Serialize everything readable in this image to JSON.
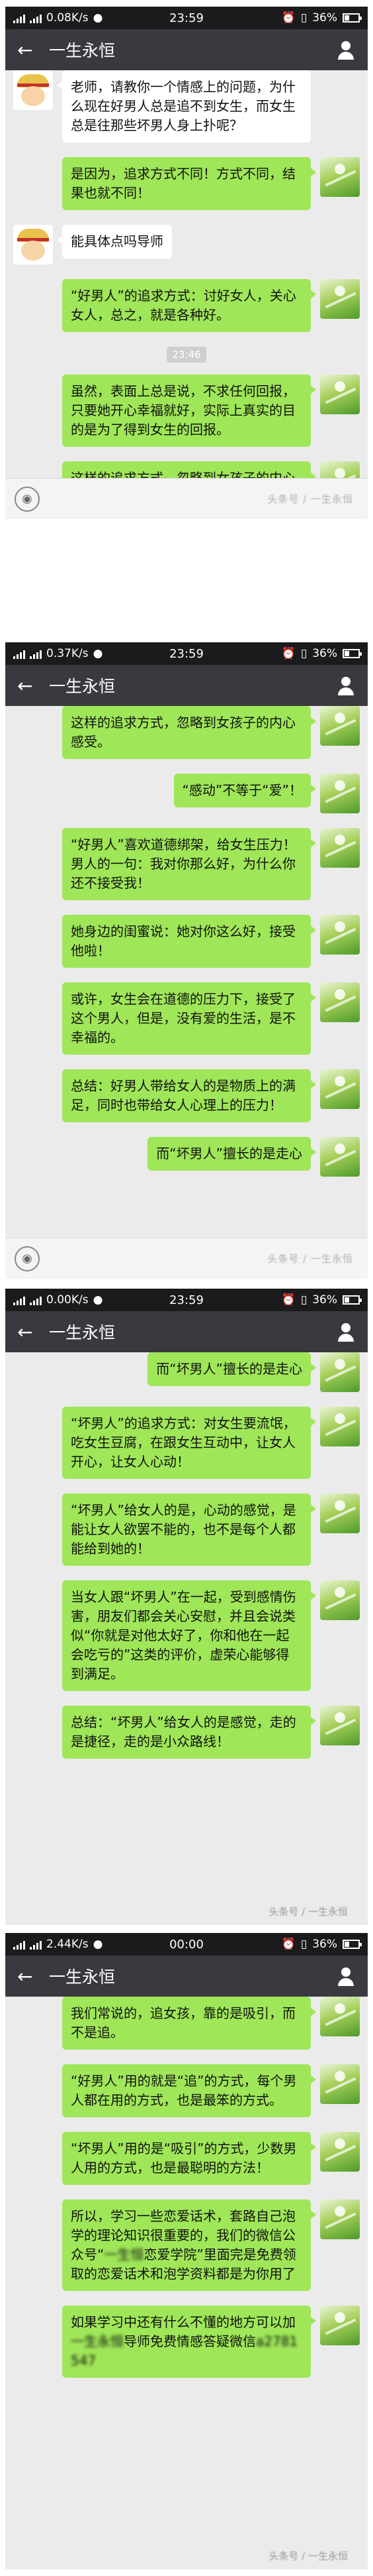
{
  "contact_name": "一生永恒",
  "back_glyph": "←",
  "panels": [
    {
      "status": {
        "speed": "0.08K/s",
        "time": "23:59",
        "battery": "36%"
      },
      "watermark": "头条号 / 一生永恒",
      "messages": [
        {
          "type": "left",
          "text": "老师，请教你一个情感上的问题，为什么现在好男人总是追不到女生，而女生总是往那些坏男人身上扑呢？"
        },
        {
          "type": "right",
          "text": "是因为，追求方式不同！方式不同，结果也就不同！"
        },
        {
          "type": "left",
          "text": "能具体点吗导师"
        },
        {
          "type": "right",
          "text": "“好男人”的追求方式：讨好女人，关心女人，总之，就是各种好。"
        },
        {
          "type": "time",
          "text": "23:46"
        },
        {
          "type": "right",
          "text": "虽然，表面上总是说，不求任何回报，只要她开心幸福就好，实际上真实的目的是为了得到女生的回报。"
        },
        {
          "type": "right",
          "text": "这样的追求方式，忽略到女孩子的内心感受。"
        }
      ]
    },
    {
      "status": {
        "speed": "0.37K/s",
        "time": "23:59",
        "battery": "36%"
      },
      "watermark": "头条号 / 一生永恒",
      "messages": [
        {
          "type": "right",
          "text": "这样的追求方式，忽略到女孩子的内心感受。"
        },
        {
          "type": "right",
          "text": "“感动”不等于“爱”！"
        },
        {
          "type": "right",
          "text": "“好男人”喜欢道德绑架，给女生压力！ 男人的一句：我对你那么好，为什么你还不接受我！"
        },
        {
          "type": "right",
          "text": "她身边的闺蜜说：她对你这么好，接受他啦！"
        },
        {
          "type": "right",
          "text": "或许，女生会在道德的压力下，接受了这个男人，但是，没有爱的生活，是不幸福的。"
        },
        {
          "type": "right",
          "text": "总结：好男人带给女人的是物质上的满足，同时也带给女人心理上的压力！"
        },
        {
          "type": "right",
          "text": "而“坏男人”擅长的是走心"
        }
      ]
    },
    {
      "status": {
        "speed": "0.00K/s",
        "time": "23:59",
        "battery": "36%"
      },
      "watermark": "头条号 / 一生永恒",
      "messages": [
        {
          "type": "right",
          "text": "而“坏男人”擅长的是走心"
        },
        {
          "type": "right",
          "text": "“坏男人”的追求方式：对女生要流氓，吃女生豆腐，在跟女生互动中，让女人开心，让女人心动！"
        },
        {
          "type": "right",
          "text": "“坏男人”给女人的是，心动的感觉，是能让女人欲罢不能的，也不是每个人都能给到她的！"
        },
        {
          "type": "right",
          "text": "当女人跟“坏男人”在一起，受到感情伤害，朋友们都会关心安慰，并且会说类似“你就是对他太好了，你和他在一起会吃亏的”这类的评价，虚荣心能够得到满足。"
        },
        {
          "type": "right",
          "text": "总结：“坏男人”给女人的是感觉，走的是捷径，走的是小众路线！"
        }
      ]
    },
    {
      "status": {
        "speed": "2.44K/s",
        "time": "00:00",
        "battery": "36%"
      },
      "watermark": "头条号 / 一生永恒",
      "messages": [
        {
          "type": "right",
          "text": "我们常说的，追女孩，靠的是吸引，而不是追。"
        },
        {
          "type": "right",
          "text": "“好男人”用的就是“追”的方式，每个男人都在用的方式，也是最笨的方式。"
        },
        {
          "type": "right",
          "text": "“坏男人”用的是“吸引”的方式，少数男人用的方式，也是最聪明的方法！"
        },
        {
          "type": "right",
          "text": "所以，学习一些恋爱话术，套路自己泡学的理论知识很重要的，我们的微信公众号“",
          "blur": "一生恒",
          "text_after": "恋爱学院”里面完是免费领取的恋爱话术和泡学资料都是为你用了"
        },
        {
          "type": "right",
          "text": "如果学习中还有什么不懂的地方可以加",
          "blur": "一生永恒",
          "text_after": "导师免费情感答疑微信",
          "blur2": "a2781547"
        }
      ]
    }
  ]
}
